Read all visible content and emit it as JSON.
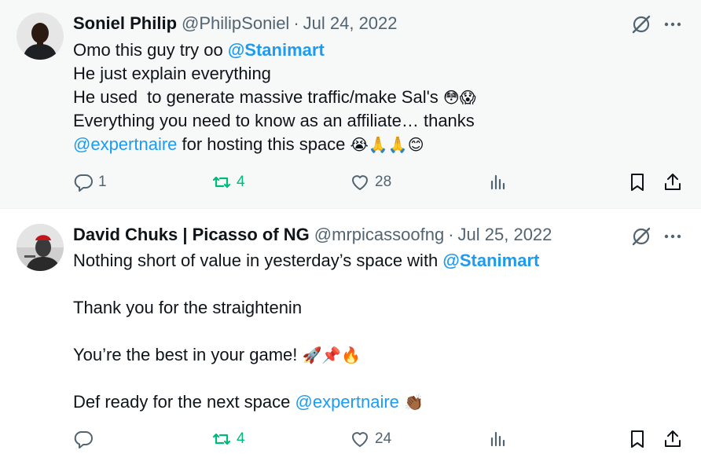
{
  "tweets": [
    {
      "display_name": "Soniel Philip",
      "handle": "@PhilipSoniel",
      "separator": "·",
      "date": "Jul 24, 2022",
      "lines": [
        [
          {
            "text": "Omo this guy try oo "
          },
          {
            "text": "@Stanimart",
            "type": "mention-bold"
          }
        ],
        [
          {
            "text": "He just explain everything"
          }
        ],
        [
          {
            "text": "He used  to generate massive traffic/make Sal's "
          },
          {
            "text": "😳😱",
            "type": "emoji"
          }
        ],
        [
          {
            "text": "Everything you need to know as an affiliate… thanks"
          }
        ],
        [
          {
            "text": "@expertnaire",
            "type": "mention"
          },
          {
            "text": " for hosting this space "
          },
          {
            "text": "😭🙏🙏😊",
            "type": "emoji"
          }
        ]
      ],
      "actions": {
        "replies": "1",
        "retweets": "4",
        "likes": "28"
      }
    },
    {
      "display_name": "David Chuks | Picasso of NG",
      "handle": "@mrpicassoofng",
      "separator": "·",
      "date": "Jul 25, 2022",
      "lines": [
        [
          {
            "text": "Nothing short of value in yesterday’s space with "
          },
          {
            "text": "@Stanimart",
            "type": "mention-bold"
          }
        ],
        [
          {
            "text": ""
          }
        ],
        [
          {
            "text": "Thank you for the straightenin"
          }
        ],
        [
          {
            "text": ""
          }
        ],
        [
          {
            "text": "You’re the best in your game! "
          },
          {
            "text": "🚀📌🔥",
            "type": "emoji"
          }
        ],
        [
          {
            "text": ""
          }
        ],
        [
          {
            "text": "Def ready for the next space "
          },
          {
            "text": "@expertnaire",
            "type": "mention"
          },
          {
            "text": " "
          },
          {
            "text": "👏🏾",
            "type": "emoji"
          }
        ]
      ],
      "actions": {
        "replies": "",
        "retweets": "4",
        "likes": "24"
      }
    }
  ],
  "icons": [
    "grok-icon",
    "more-icon",
    "reply-icon",
    "retweet-icon",
    "like-icon",
    "views-icon",
    "bookmark-icon",
    "share-icon"
  ],
  "colors": {
    "link": "#1d9bf0",
    "secondary_text": "#536471",
    "retweet_green": "#00ba7c",
    "hover_bg": "#f7f9f9"
  }
}
